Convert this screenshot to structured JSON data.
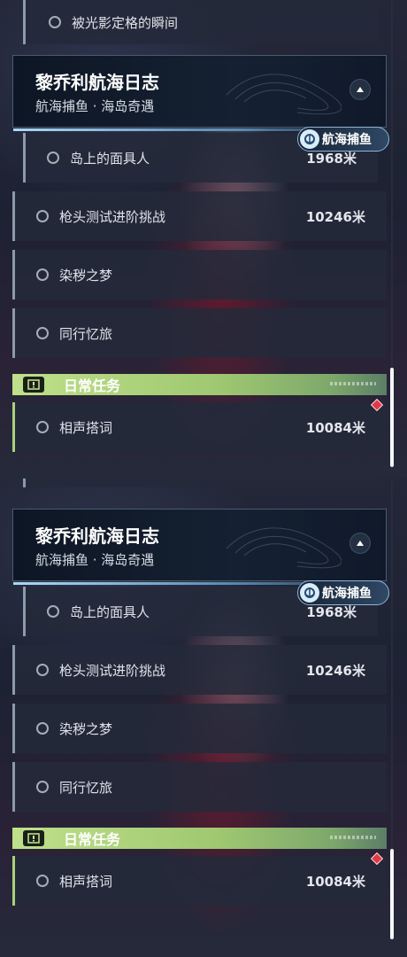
{
  "partial_item": {
    "label": "被光影定格的瞬间"
  },
  "quest_group": {
    "title": "黎乔利航海日志",
    "subtitle": "航海捕鱼 · 海岛奇遇",
    "badge": "航海捕鱼"
  },
  "quests": [
    {
      "label": "岛上的面具人",
      "distance": "1968米"
    },
    {
      "label": "枪头测试进阶挑战",
      "distance": "10246米"
    },
    {
      "label": "染秽之梦",
      "distance": ""
    },
    {
      "label": "同行忆旅",
      "distance": ""
    }
  ],
  "daily_section": {
    "title": "日常任务",
    "items": [
      {
        "label": "相声搭词",
        "distance": "10084米"
      }
    ]
  },
  "icons": {
    "collapse": "chevron-up-icon",
    "radio": "radio-circle-icon",
    "daily": "exclamation-box-icon",
    "badge": "fishing-emblem-icon",
    "alert": "red-diamond-icon"
  },
  "colors": {
    "daily_accent": "#a9d17a",
    "row_bg": "#242a3a",
    "alert": "#e0394a"
  }
}
